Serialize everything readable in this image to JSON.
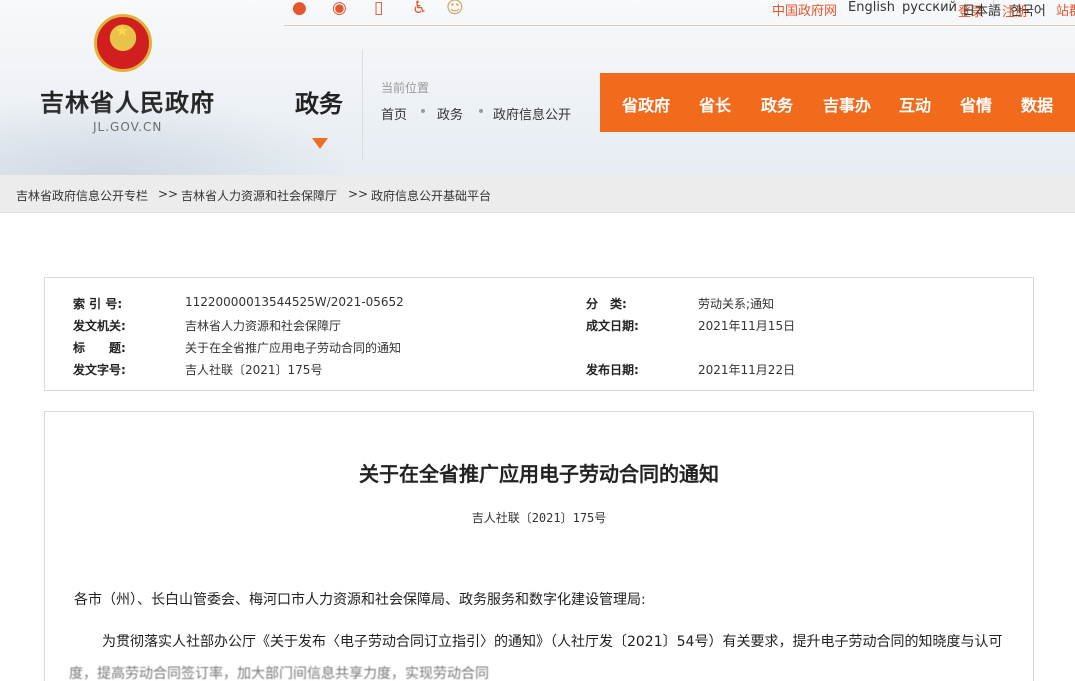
{
  "header": {
    "site_name": "吉林省人民政府",
    "site_domain": "JL.GOV.CN",
    "section_title": "政务",
    "location_label": "当前位置",
    "location": [
      "首页",
      "政务",
      "政府信息公开"
    ]
  },
  "topbar": {
    "icons": [
      "weibo-icon",
      "weibo-icon",
      "mobile-icon",
      "accessibility-icon",
      "mascot-icon"
    ],
    "login": "登录",
    "register": "注册",
    "links": [
      "中国政府网",
      "English",
      "русский",
      "日本語",
      "한국어",
      "站群"
    ]
  },
  "nav": [
    "省政府",
    "省长",
    "政务",
    "吉事办",
    "互动",
    "省情",
    "数据"
  ],
  "breadcrumb": [
    "吉林省政府信息公开专栏",
    "吉林省人力资源和社会保障厅",
    "政府信息公开基础平台"
  ],
  "breadcrumb_sep": ">>",
  "info": {
    "index_label": "索 引 号:",
    "index_value": "11220000013544525W/2021-05652",
    "category_label": "分　类:",
    "category_value": "劳动关系;通知",
    "issuer_label": "发文机关:",
    "issuer_value": "吉林省人力资源和社会保障厅",
    "date_label": "成文日期:",
    "date_value": "2021年11月15日",
    "title_label": "标　　题:",
    "title_value": "关于在全省推广应用电子劳动合同的通知",
    "docno_label": "发文字号:",
    "docno_value": "吉人社联〔2021〕175号",
    "publish_label": "发布日期:",
    "publish_value": "2021年11月22日"
  },
  "article": {
    "title": "关于在全省推广应用电子劳动合同的通知",
    "doc_number": "吉人社联〔2021〕175号",
    "salutation": "各市（州）、长白山管委会、梅河口市人力资源和社会保障局、政务服务和数字化建设管理局:",
    "para1": "为贯彻落实人社部办公厅《关于发布〈电子劳动合同订立指引〉的通知》（人社厅发〔2021〕54号）有关要求，提升电子劳动合同的知晓度与认可",
    "para1_cut": "度，提高劳动合同签订率，加大部门间信息共享力度，实现劳动合同"
  },
  "colors": {
    "accent": "#f26b1d",
    "link_red": "#e4572e",
    "crumb_bg": "#ececec"
  }
}
